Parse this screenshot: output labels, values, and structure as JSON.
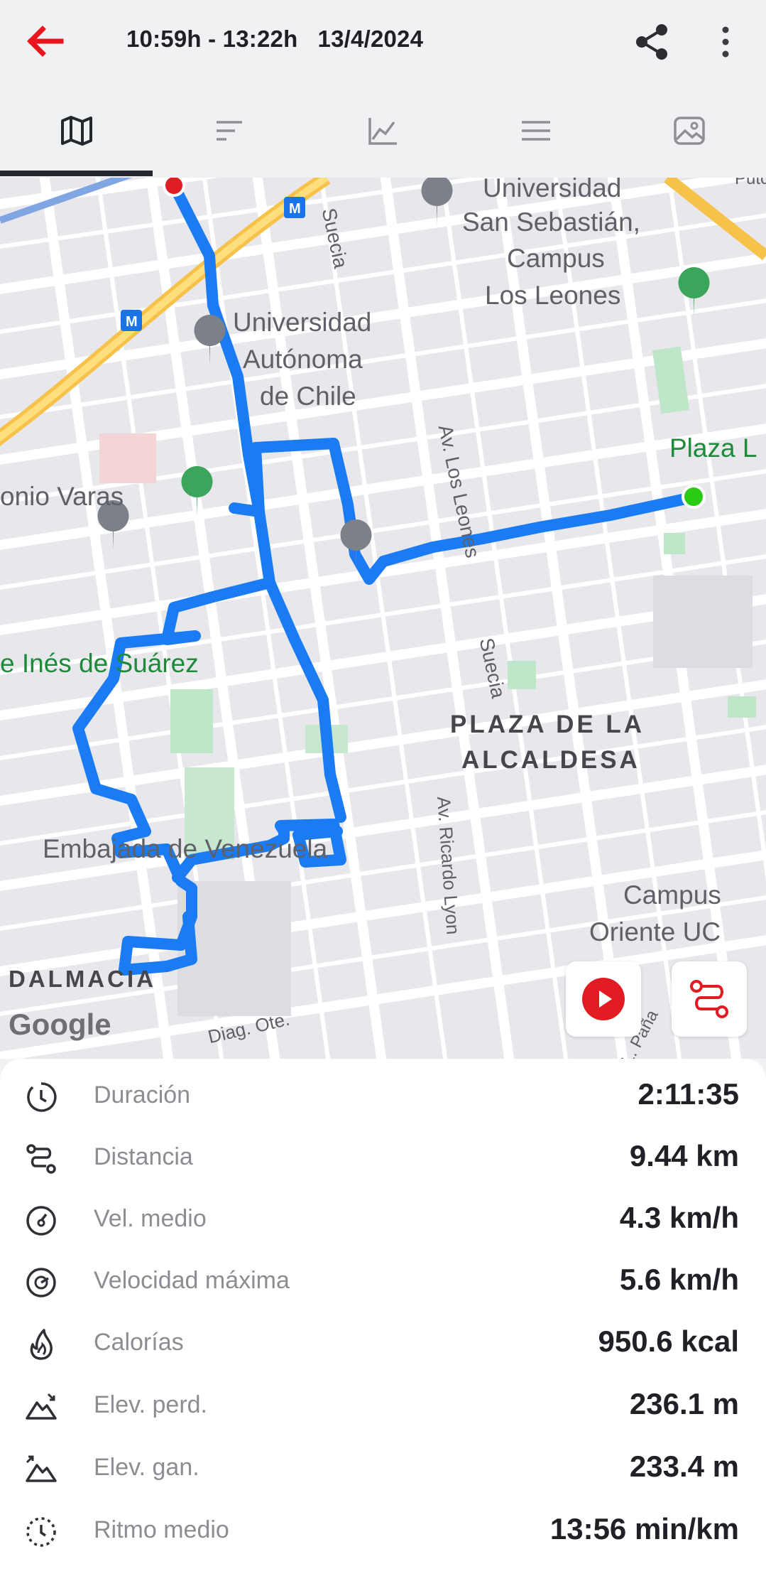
{
  "header": {
    "title": "10:59h - 13:22h   13/4/2024",
    "back_icon": "arrow-left-icon",
    "share_icon": "share-icon",
    "more_icon": "more-vertical-icon",
    "accent_color": "#e8161c"
  },
  "tabs": [
    {
      "name": "map",
      "icon": "map-icon",
      "active": true
    },
    {
      "name": "laps",
      "icon": "bars-icon",
      "active": false
    },
    {
      "name": "chart",
      "icon": "chart-icon",
      "active": false
    },
    {
      "name": "details",
      "icon": "menu-icon",
      "active": false
    },
    {
      "name": "photos",
      "icon": "photo-icon",
      "active": false
    }
  ],
  "map": {
    "labels": {
      "universidad_ss": "Universidad",
      "universidad_ss_2": "San Sebastián,",
      "universidad_ss_3": "Campus",
      "universidad_ss_4": "Los Leones",
      "uach_1": "Universidad",
      "uach_2": "Autónoma",
      "uach_3": "de Chile",
      "plaza": "Plaza L",
      "nio_varas": "onio Varas",
      "ines": "e Inés de Suárez",
      "alcaldesa_1": "PLAZA DE LA",
      "alcaldesa_2": "ALCALDESA",
      "embajada": "Embajada de Venezuela",
      "campus_1": "Campus",
      "campus_2": "Oriente UC",
      "dalmacia": "DALMACIA",
      "google": "Google",
      "suecia_1": "Suecia",
      "suecia_2": "Suecia",
      "los_leones": "Av. Los Leones",
      "ricardo_lyon": "Av. Ricardo Lyon",
      "diag_ote": "Diag. Ote.",
      "pana": "L. Paña",
      "puto": "Puto"
    },
    "route_color": "#1a7bf2",
    "start_color": "#2ccc16",
    "end_color": "#e11d24",
    "play_icon": "play-icon",
    "route_icon": "route-icon"
  },
  "stats": [
    {
      "icon": "clock-icon",
      "label": "Duración",
      "value": "2:11:35"
    },
    {
      "icon": "distance-icon",
      "label": "Distancia",
      "value": "9.44 km"
    },
    {
      "icon": "speedometer-icon",
      "label": "Vel. medio",
      "value": "4.3 km/h"
    },
    {
      "icon": "max-speed-icon",
      "label": "Velocidad máxima",
      "value": "5.6 km/h"
    },
    {
      "icon": "flame-icon",
      "label": "Calorías",
      "value": "950.6 kcal"
    },
    {
      "icon": "elevation-loss-icon",
      "label": "Elev. perd.",
      "value": "236.1 m"
    },
    {
      "icon": "elevation-gain-icon",
      "label": "Elev. gan.",
      "value": "233.4 m"
    },
    {
      "icon": "pace-icon",
      "label": "Ritmo medio",
      "value": "13:56 min/km"
    }
  ]
}
